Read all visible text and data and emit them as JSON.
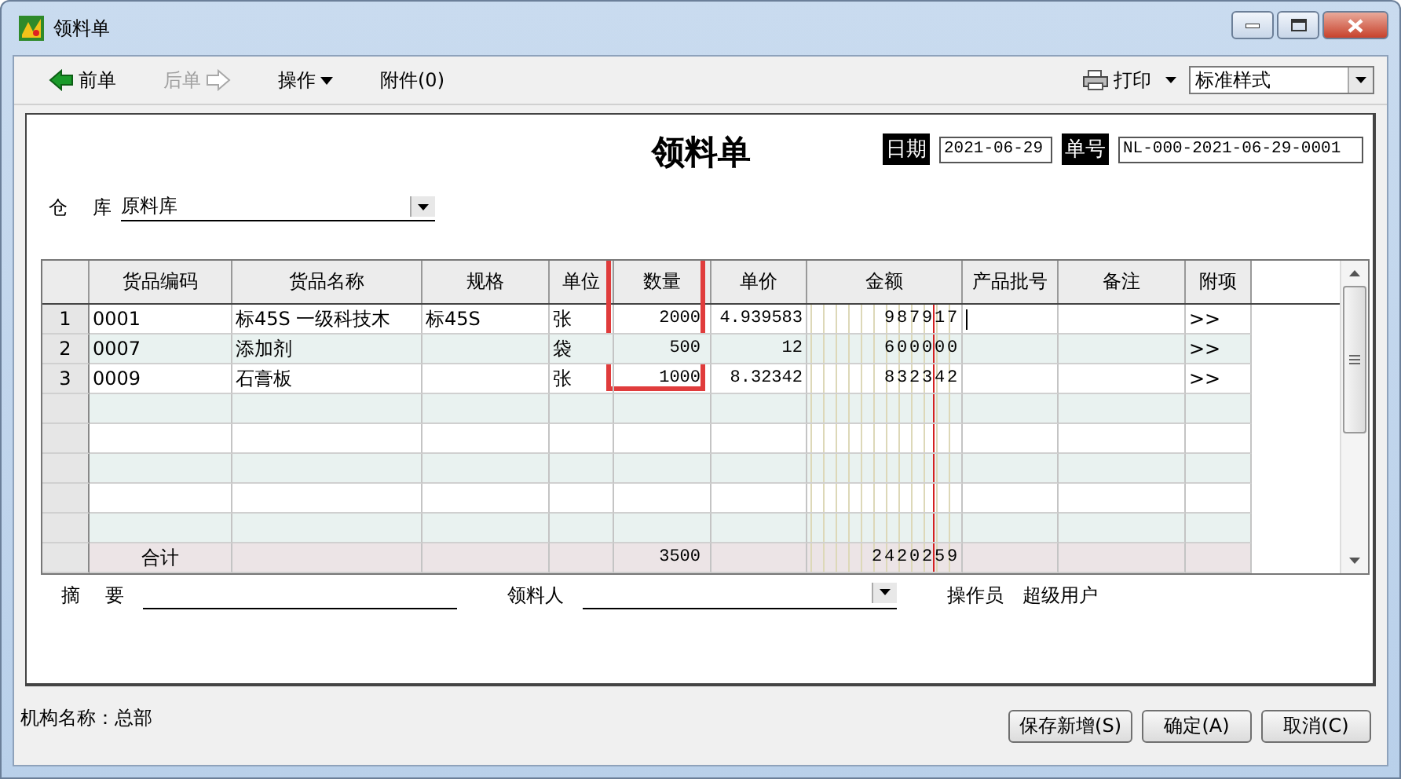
{
  "window": {
    "title": "领料单"
  },
  "toolbar": {
    "items": [
      {
        "label": "前单",
        "kind": "back",
        "disabled": false
      },
      {
        "label": "后单",
        "kind": "forward",
        "disabled": true
      },
      {
        "label": "操作",
        "kind": "menu",
        "disabled": false
      },
      {
        "label": "附件(0)",
        "kind": "plain",
        "disabled": false
      }
    ],
    "print": "打印",
    "style_select": {
      "value": "标准样式"
    }
  },
  "document": {
    "title": "领料单",
    "date_label": "日期",
    "date": "2021-06-29",
    "number_label": "单号",
    "number": "NL-000-2021-06-29-0001",
    "warehouse_label": "仓 库",
    "warehouse": "原料库"
  },
  "grid": {
    "columns": [
      {
        "label": "货品编码",
        "highlighted": false
      },
      {
        "label": "货品名称",
        "highlighted": false
      },
      {
        "label": "规格",
        "highlighted": false
      },
      {
        "label": "单位",
        "highlighted": false
      },
      {
        "label": "数量",
        "highlighted": true
      },
      {
        "label": "单价",
        "highlighted": false
      },
      {
        "label": "金额",
        "highlighted": false
      },
      {
        "label": "产品批号",
        "highlighted": false
      },
      {
        "label": "备注",
        "highlighted": false
      },
      {
        "label": "附项",
        "highlighted": false
      }
    ],
    "rows": [
      {
        "number": "1",
        "code": "0001",
        "name": "标45S 一级科技木",
        "spec": "标45S",
        "unit": "张",
        "quantity": "2000",
        "price": "4.939583",
        "amount": "987917",
        "batch": "",
        "note": "",
        "extra": ">>",
        "editing": true
      },
      {
        "number": "2",
        "code": "0007",
        "name": "添加剂",
        "spec": "",
        "unit": "袋",
        "quantity": "500",
        "price": "12",
        "amount": "600000",
        "batch": "",
        "note": "",
        "extra": ">>",
        "editing": false
      },
      {
        "number": "3",
        "code": "0009",
        "name": "石膏板",
        "spec": "",
        "unit": "张",
        "quantity": "1000",
        "price": "8.32342",
        "amount": "832342",
        "batch": "",
        "note": "",
        "extra": ">>",
        "editing": false
      }
    ],
    "total": {
      "label": "合计",
      "quantity": "3500",
      "amount": "2420259"
    }
  },
  "bottom": {
    "summary_label": "摘 要",
    "receiver_label": "领料人",
    "operator_label": "操作员",
    "operator": "超级用户"
  },
  "footer": {
    "organization": "机构名称：总部",
    "buttons": [
      "保存新增(S)",
      "确定(A)",
      "取消(C)"
    ]
  }
}
